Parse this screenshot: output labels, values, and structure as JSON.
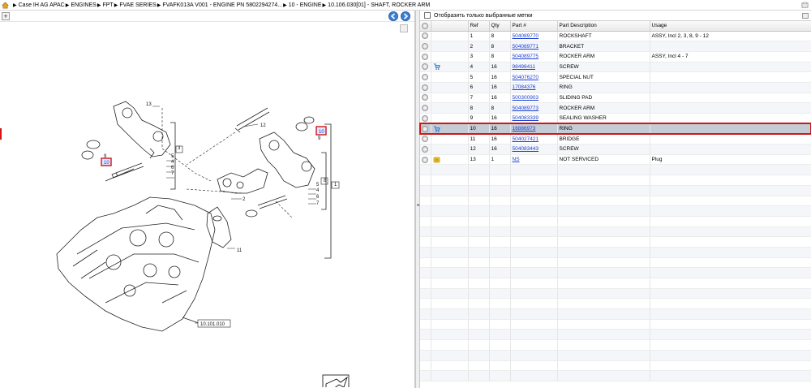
{
  "breadcrumb": [
    "Case IH AG APAC",
    "ENGINES",
    "FPT",
    "FVAE SERIES",
    "FVAFK013A V001 - ENGINE PN 5802294274...",
    "10 - ENGINE",
    "10.106.030[01] - SHAFT, ROCKER ARM"
  ],
  "left": {
    "zoom_label": "+",
    "callouts": {
      "c13": "13",
      "c12": "12",
      "c10a": "10",
      "c9a": "9",
      "c10b": "10",
      "c9b": "9",
      "c5a": "5",
      "c4a": "4",
      "c6a": "6",
      "c7a": "7",
      "c3": "3",
      "c2": "2",
      "c5b": "5",
      "c4b": "4",
      "c6b": "6",
      "c7b": "7",
      "c8": "8",
      "c1": "1",
      "c11": "11",
      "ref": "10.101.010"
    }
  },
  "right": {
    "filter_label": "Отобразить только выбранные метки",
    "columns": [
      "",
      "",
      "Ref",
      "Qty",
      "Part #",
      "Part Description",
      "Usage"
    ],
    "rows": [
      {
        "ref": "1",
        "qty": "8",
        "part": "504089770",
        "desc": "ROCKSHAFT",
        "usage": "ASSY, Incl 2, 3, 8, 9 - 12",
        "icon": ""
      },
      {
        "ref": "2",
        "qty": "8",
        "part": "504089771",
        "desc": "BRACKET",
        "usage": "",
        "icon": ""
      },
      {
        "ref": "3",
        "qty": "8",
        "part": "504089775",
        "desc": "ROCKER ARM",
        "usage": "ASSY, Incl 4 - 7",
        "icon": ""
      },
      {
        "ref": "4",
        "qty": "16",
        "part": "98498411",
        "desc": "SCREW",
        "usage": "",
        "icon": "cart"
      },
      {
        "ref": "5",
        "qty": "16",
        "part": "504076270",
        "desc": "SPECIAL NUT",
        "usage": "",
        "icon": ""
      },
      {
        "ref": "6",
        "qty": "16",
        "part": "17084376",
        "desc": "RING",
        "usage": "",
        "icon": ""
      },
      {
        "ref": "7",
        "qty": "16",
        "part": "500300903",
        "desc": "SLIDING PAD",
        "usage": "",
        "icon": ""
      },
      {
        "ref": "8",
        "qty": "8",
        "part": "504089773",
        "desc": "ROCKER ARM",
        "usage": "",
        "icon": ""
      },
      {
        "ref": "9",
        "qty": "16",
        "part": "504083339",
        "desc": "SEALING WASHER",
        "usage": "",
        "icon": ""
      },
      {
        "ref": "10",
        "qty": "16",
        "part": "16886973",
        "desc": "RING",
        "usage": "",
        "icon": "cart",
        "selected": true
      },
      {
        "ref": "11",
        "qty": "16",
        "part": "504027421",
        "desc": "BRIDGE",
        "usage": "",
        "icon": ""
      },
      {
        "ref": "12",
        "qty": "16",
        "part": "504083443",
        "desc": "SCREW",
        "usage": "",
        "icon": ""
      },
      {
        "ref": "13",
        "qty": "1",
        "part": "NS",
        "desc": "NOT SERVICED",
        "usage": "Plug",
        "icon": "note"
      }
    ]
  },
  "colors": {
    "link": "#1a3fd1",
    "selection_outline": "#d01616",
    "selected_row": "#c5ccd6",
    "nav_button": "#3b7fd4"
  }
}
